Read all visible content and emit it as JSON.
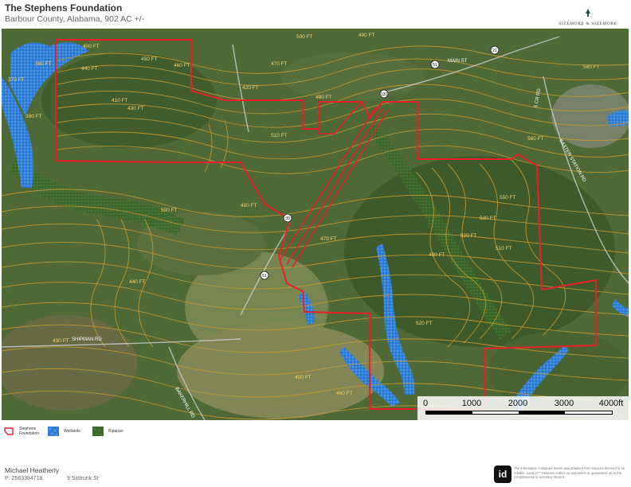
{
  "header": {
    "title": "The Stephens Foundation",
    "subtitle": "Barbour County, Alabama, 902 AC +/-",
    "brand": "SIZEMORE & SIZEMORE"
  },
  "map": {
    "contour_labels": [
      "500 FT",
      "490 FT",
      "470 FT",
      "440 FT",
      "450 FT",
      "400 FT",
      "460 FT",
      "430 FT",
      "420 FT",
      "410 FT",
      "510 FT",
      "480 FT",
      "520 FT",
      "530 FT",
      "540 FT",
      "550 FT",
      "560 FT",
      "380 FT",
      "370 FT",
      "390 FT"
    ],
    "road_labels": {
      "main_st": "MAIN ST",
      "shipman_rd": "SHIPMAN RD",
      "bakerhill_rd": "BAKERHILL RD",
      "baxter_station_rd": "BAXTER STATION RD",
      "cr_rd": "S CR RD"
    },
    "road_markers": [
      "51",
      "21",
      "131",
      "39"
    ],
    "colors": {
      "boundary": "#e8202a",
      "wetlands": "#2d7fd6",
      "riparian": "#3f6f2a",
      "contour": "#c99a2e",
      "terrain": "#4d6b35"
    }
  },
  "scale": {
    "ticks": [
      "0",
      "1000",
      "2000",
      "3000",
      "4000ft"
    ]
  },
  "legend": {
    "items": [
      {
        "label_line1": "Stephens",
        "label_line2": "Foundation",
        "icon": "parcel-boundary-icon"
      },
      {
        "label_line1": "Wetlands",
        "label_line2": "",
        "icon": "wetlands-pattern-icon"
      },
      {
        "label_line1": "Riparian",
        "label_line2": "",
        "icon": "riparian-pattern-icon"
      }
    ]
  },
  "footer": {
    "agent_name": "Michael Heatherly",
    "agent_phone": "P: 2563384718",
    "agent_address": "9 Sistrunk St",
    "disclaimer": "The information contained herein was obtained from sources deemed to be reliable. Land id™ Services makes no warranties or guarantees as to the completeness or accuracy thereof.",
    "logo_text": "id"
  }
}
